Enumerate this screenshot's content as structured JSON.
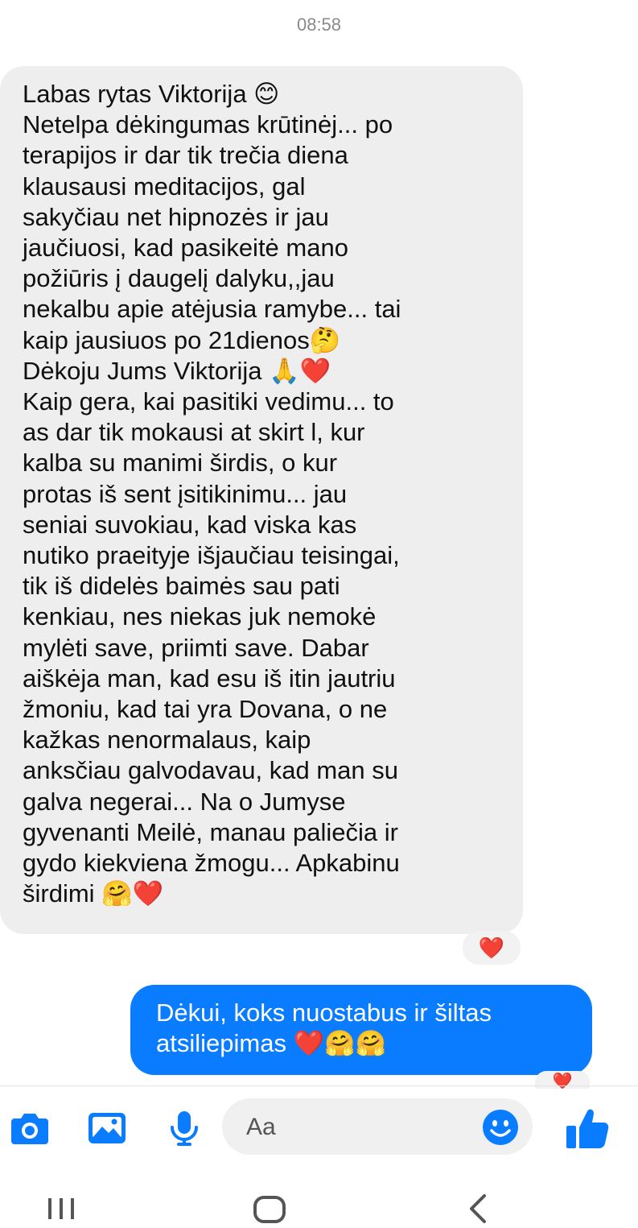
{
  "timestamp": "08:58",
  "incoming_message": {
    "lines": [
      "Labas rytas Viktorija 😊",
      "Netelpa dėkingumas krūtinėj... po",
      "terapijos ir dar tik trečia diena",
      "klausausi meditacijos, gal",
      "sakyčiau net hipnozės ir jau",
      "jaučiuosi, kad pasikeitė mano",
      "požiūris į daugelį dalyku,,jau",
      "nekalbu apie atėjusia ramybe... tai",
      "kaip jausiuos po 21dienos🤔",
      "Dėkoju Jums Viktorija 🙏❤️",
      "Kaip gera, kai pasitiki vedimu... to",
      "as dar tik mokausi at skirt l, kur",
      "kalba su manimi širdis, o kur",
      "protas iš sent įsitikinimu... jau",
      "seniai suvokiau, kad viska kas",
      "nutiko praeityje išjaučiau teisingai,",
      "tik iš didelės baimės sau pati",
      "kenkiau, nes niekas juk nemokė",
      "mylėti save, priimti save. Dabar",
      "aiškėja man, kad esu iš itin jautriu",
      "žmoniu, kad tai yra Dovana, o ne",
      "kažkas nenormalaus, kaip",
      "anksčiau galvodavau, kad man su",
      "galva negerai... Na o Jumyse",
      "gyvenanti  Meilė, manau paliečia ir",
      "gydo kiekviena žmogu... Apkabinu",
      "širdimi 🤗❤️"
    ],
    "reaction": "❤️"
  },
  "outgoing_message": {
    "lines": [
      "Dėkui, koks nuostabus ir šiltas",
      "atsiliepimas ❤️🤗🤗"
    ],
    "reaction": "❤️"
  },
  "composer": {
    "placeholder": "Aa",
    "icons": [
      "camera-icon",
      "image-icon",
      "microphone-icon",
      "emoji-icon",
      "thumbs-up-icon"
    ]
  },
  "navbar": {
    "icons": [
      "recent-apps-icon",
      "home-icon",
      "back-icon"
    ]
  },
  "colors": {
    "accent": "#0a7cff",
    "incoming_bubble": "#eeeeef",
    "heart": "#e41e3f",
    "timestamp": "#8a8a8a"
  }
}
